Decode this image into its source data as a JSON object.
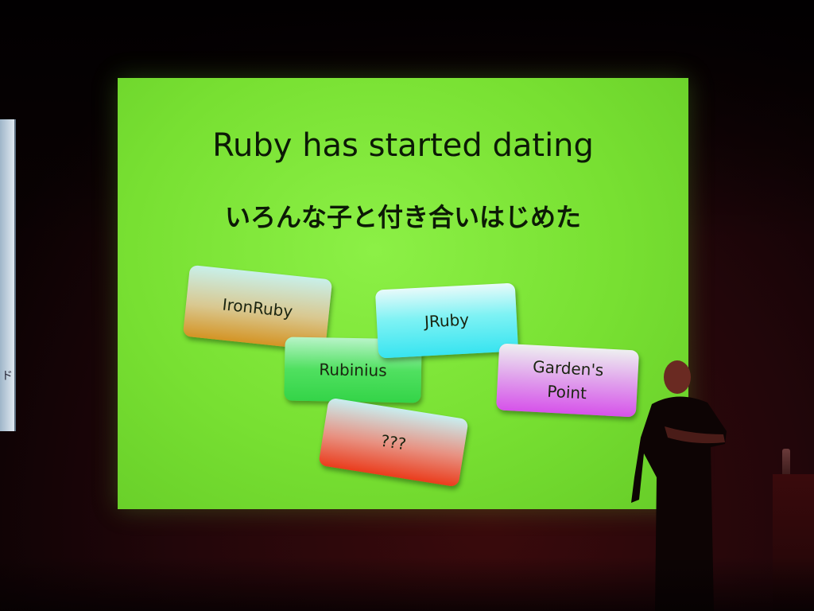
{
  "slide": {
    "title": "Ruby has started dating",
    "subtitle": "いろんな子と付き合いはじめた",
    "cards": {
      "ironruby": "IronRuby",
      "rubinius": "Rubinius",
      "jruby": "JRuby",
      "gardens_point_line1": "Garden's",
      "gardens_point_line2": "Point",
      "unknown": "???"
    }
  },
  "side_screen": {
    "glyph": "ド"
  },
  "colors": {
    "slide_background": "#78e032",
    "title_text": "#0c1a06",
    "room_background": "#22060a"
  }
}
